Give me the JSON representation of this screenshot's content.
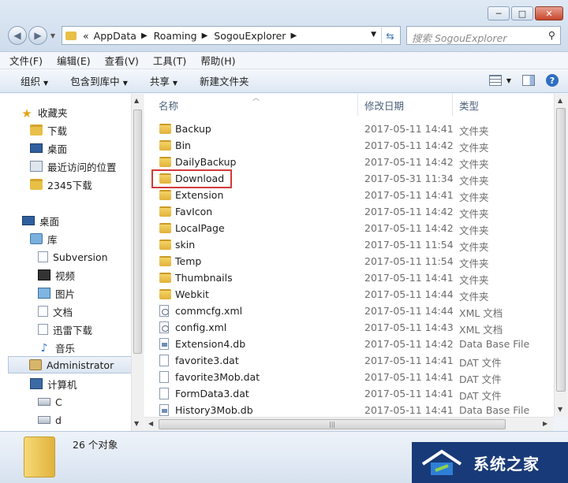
{
  "window": {
    "controls": [
      "─",
      "□",
      "✕"
    ],
    "address": [
      "AppData",
      "Roaming",
      "SogouExplorer"
    ],
    "address_prefix": "«",
    "search_placeholder": "搜索 SogouExplorer"
  },
  "menu": [
    "文件(F)",
    "编辑(E)",
    "查看(V)",
    "工具(T)",
    "帮助(H)"
  ],
  "commands": [
    "组织",
    "包含到库中",
    "共享",
    "新建文件夹"
  ],
  "nav": {
    "favorites_title": "收藏夹",
    "favorites": [
      "下载",
      "桌面",
      "最近访问的位置",
      "2345下载"
    ],
    "desktop": "桌面",
    "library": "库",
    "libraries": [
      "Subversion",
      "视频",
      "图片",
      "文档",
      "迅雷下载",
      "音乐"
    ],
    "user": "Administrator",
    "computer": "计算机",
    "drives": [
      "C",
      "d"
    ]
  },
  "columns": {
    "name": "名称",
    "date": "修改日期",
    "type": "类型"
  },
  "files": [
    {
      "name": "Backup",
      "date": "2017-05-11 14:41",
      "type": "文件夹",
      "icon": "folder"
    },
    {
      "name": "Bin",
      "date": "2017-05-11 14:42",
      "type": "文件夹",
      "icon": "folder"
    },
    {
      "name": "DailyBackup",
      "date": "2017-05-11 14:42",
      "type": "文件夹",
      "icon": "folder"
    },
    {
      "name": "Download",
      "date": "2017-05-31 11:34",
      "type": "文件夹",
      "icon": "folder"
    },
    {
      "name": "Extension",
      "date": "2017-05-11 14:41",
      "type": "文件夹",
      "icon": "folder"
    },
    {
      "name": "FavIcon",
      "date": "2017-05-11 14:42",
      "type": "文件夹",
      "icon": "folder"
    },
    {
      "name": "LocalPage",
      "date": "2017-05-11 14:42",
      "type": "文件夹",
      "icon": "folder"
    },
    {
      "name": "skin",
      "date": "2017-05-11 11:54",
      "type": "文件夹",
      "icon": "folder"
    },
    {
      "name": "Temp",
      "date": "2017-05-11 11:54",
      "type": "文件夹",
      "icon": "folder"
    },
    {
      "name": "Thumbnails",
      "date": "2017-05-11 14:41",
      "type": "文件夹",
      "icon": "folder"
    },
    {
      "name": "Webkit",
      "date": "2017-05-11 14:44",
      "type": "文件夹",
      "icon": "folder"
    },
    {
      "name": "commcfg.xml",
      "date": "2017-05-11 14:44",
      "type": "XML 文档",
      "icon": "xml"
    },
    {
      "name": "config.xml",
      "date": "2017-05-11 14:43",
      "type": "XML 文档",
      "icon": "xml"
    },
    {
      "name": "Extension4.db",
      "date": "2017-05-11 14:42",
      "type": "Data Base File",
      "icon": "db"
    },
    {
      "name": "favorite3.dat",
      "date": "2017-05-11 14:41",
      "type": "DAT 文件",
      "icon": "file"
    },
    {
      "name": "favorite3Mob.dat",
      "date": "2017-05-11 14:41",
      "type": "DAT 文件",
      "icon": "file"
    },
    {
      "name": "FormData3.dat",
      "date": "2017-05-11 14:41",
      "type": "DAT 文件",
      "icon": "file"
    },
    {
      "name": "History3Mob.db",
      "date": "2017-05-11 14:41",
      "type": "Data Base File",
      "icon": "db"
    }
  ],
  "status": {
    "count": "26 个对象"
  },
  "watermark": {
    "text": "系统之家"
  }
}
